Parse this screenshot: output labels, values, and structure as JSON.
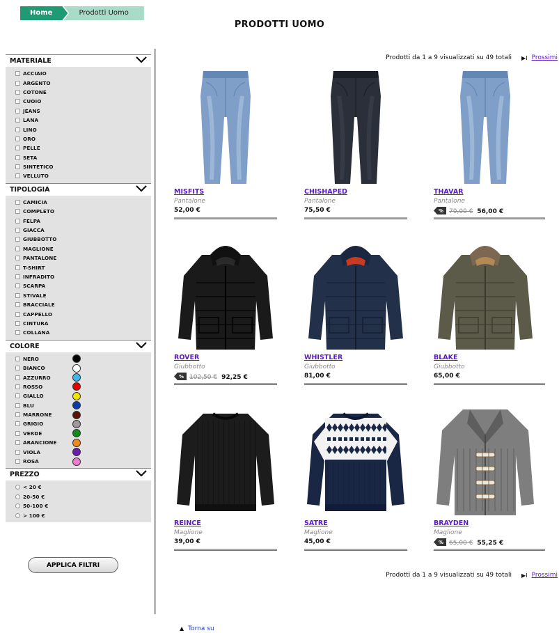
{
  "breadcrumb": {
    "home": "Home",
    "current": "Prodotti Uomo"
  },
  "page_title": "PRODOTTI UOMO",
  "filters": {
    "materiale": {
      "title": "MATERIALE",
      "items": [
        "ACCIAIO",
        "ARGENTO",
        "COTONE",
        "CUOIO",
        "JEANS",
        "LANA",
        "LINO",
        "ORO",
        "PELLE",
        "SETA",
        "SINTETICO",
        "VELLUTO"
      ]
    },
    "tipologia": {
      "title": "TIPOLOGIA",
      "items": [
        "CAMICIA",
        "COMPLETO",
        "FELPA",
        "GIACCA",
        "GIUBBOTTO",
        "MAGLIONE",
        "PANTALONE",
        "T-SHIRT",
        "INFRADITO",
        "SCARPA",
        "STIVALE",
        "BRACCIALE",
        "CAPPELLO",
        "CINTURA",
        "COLLANA"
      ]
    },
    "colore": {
      "title": "COLORE",
      "items": [
        {
          "label": "NERO",
          "color": "#000000"
        },
        {
          "label": "BIANCO",
          "color": "#ffffff"
        },
        {
          "label": "AZZURRO",
          "color": "#3fb7e8"
        },
        {
          "label": "ROSSO",
          "color": "#e00000"
        },
        {
          "label": "GIALLO",
          "color": "#f4e400"
        },
        {
          "label": "BLU",
          "color": "#0a3aa8"
        },
        {
          "label": "MARRONE",
          "color": "#5a1208"
        },
        {
          "label": "GRIGIO",
          "color": "#9a9a9a"
        },
        {
          "label": "VERDE",
          "color": "#118a1a"
        },
        {
          "label": "ARANCIONE",
          "color": "#f08a20"
        },
        {
          "label": "VIOLA",
          "color": "#6a1fa8"
        },
        {
          "label": "ROSA",
          "color": "#f07ad0"
        }
      ]
    },
    "prezzo": {
      "title": "PREZZO",
      "items": [
        "< 20 €",
        "20-50 €",
        "50-100 €",
        "> 100 €"
      ]
    }
  },
  "apply_button": "APPLICA FILTRI",
  "pagination": {
    "info": "Prodotti da 1 a 9 visualizzati su 49 totali",
    "last_icon": "▶I",
    "next": "Prossimi"
  },
  "products": [
    {
      "name": "MISFITS",
      "type": "Pantalone",
      "price": "52,00 €",
      "old_price": "",
      "image": "jeans-light"
    },
    {
      "name": "CHISHAPED",
      "type": "Pantalone",
      "price": "75,50 €",
      "old_price": "",
      "image": "jeans-dark"
    },
    {
      "name": "THAVAR",
      "type": "Pantalone",
      "price": "56,00 €",
      "old_price": "70,00 €",
      "image": "jeans-light"
    },
    {
      "name": "ROVER",
      "type": "Giubbotto",
      "price": "92,25 €",
      "old_price": "102,50 €",
      "image": "jacket-black"
    },
    {
      "name": "WHISTLER",
      "type": "Giubbotto",
      "price": "81,00 €",
      "old_price": "",
      "image": "jacket-navy"
    },
    {
      "name": "BLAKE",
      "type": "Giubbotto",
      "price": "65,00 €",
      "old_price": "",
      "image": "jacket-olive"
    },
    {
      "name": "REINCE",
      "type": "Maglione",
      "price": "39,00 €",
      "old_price": "",
      "image": "sweater-black"
    },
    {
      "name": "SATRE",
      "type": "Maglione",
      "price": "45,00 €",
      "old_price": "",
      "image": "sweater-fairisle"
    },
    {
      "name": "BRAYDEN",
      "type": "Maglione",
      "price": "55,25 €",
      "old_price": "65,00 €",
      "image": "cardigan-grey"
    }
  ],
  "back_to_top": "Torna su",
  "icons": {
    "chevron": "chevron-down-icon",
    "sale": "sale-tag-icon",
    "arrow_up": "arrow-up-icon"
  }
}
